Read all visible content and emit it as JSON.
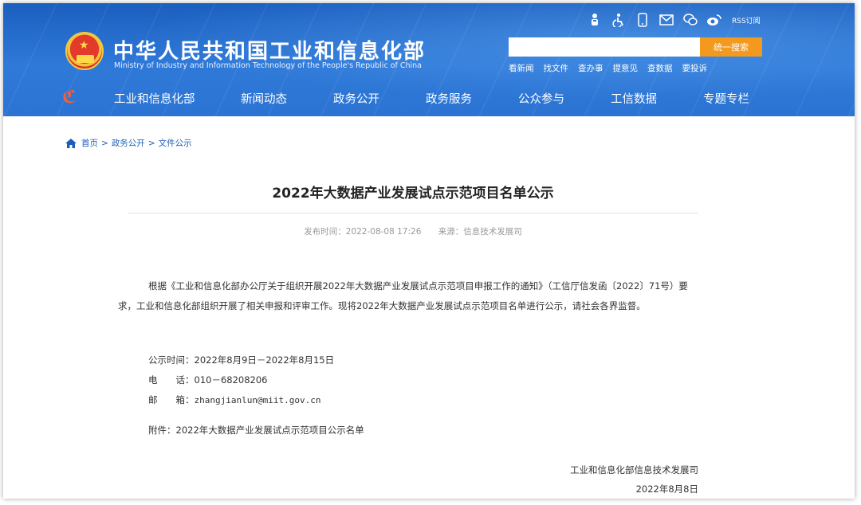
{
  "header": {
    "title": "中华人民共和国工业和信息化部",
    "subtitle": "Ministry of Industry and Information Technology of the People's Republic of China",
    "icons": [
      "mascot-icon",
      "accessibility-icon",
      "mobile-icon",
      "mail-icon",
      "wechat-icon",
      "weibo-icon"
    ],
    "rss_label": "RSS订阅",
    "search": {
      "placeholder": "",
      "button_label": "统一搜索"
    },
    "quick_links": [
      "看新闻",
      "找文件",
      "查办事",
      "提意见",
      "查数据",
      "要投诉"
    ],
    "nav": [
      "工业和信息化部",
      "新闻动态",
      "政务公开",
      "政务服务",
      "公众参与",
      "工信数据",
      "专题专栏"
    ],
    "colors": {
      "header_blue": "#2b74d3",
      "search_orange": "#f39a1e"
    }
  },
  "breadcrumb": [
    "首页",
    "政务公开",
    "文件公示"
  ],
  "breadcrumb_sep": ">",
  "article": {
    "title": "2022年大数据产业发展试点示范项目名单公示",
    "publish_label": "发布时间：2022-08-08 17:26",
    "source_label": "来源：信息技术发展司",
    "body": "根据《工业和信息化部办公厅关于组织开展2022年大数据产业发展试点示范项目申报工作的通知》（工信厅信发函〔2022〕71号）要求，工业和信息化部组织开展了相关申报和评审工作。现将2022年大数据产业发展试点示范项目名单进行公示，请社会各界监督。",
    "info": [
      {
        "label": "公示时间：",
        "value": "2022年8月9日－2022年8月15日"
      },
      {
        "label": "电　　话：",
        "value": "010－68208206"
      },
      {
        "label": "邮　　箱：",
        "value": "zhangjianlun@miit.gov.cn"
      }
    ],
    "attachment_label": "附件：",
    "attachment_link": "2022年大数据产业发展试点示范项目公示名单",
    "signature_org": "工业和信息化部信息技术发展司",
    "signature_date": "2022年8月8日"
  }
}
